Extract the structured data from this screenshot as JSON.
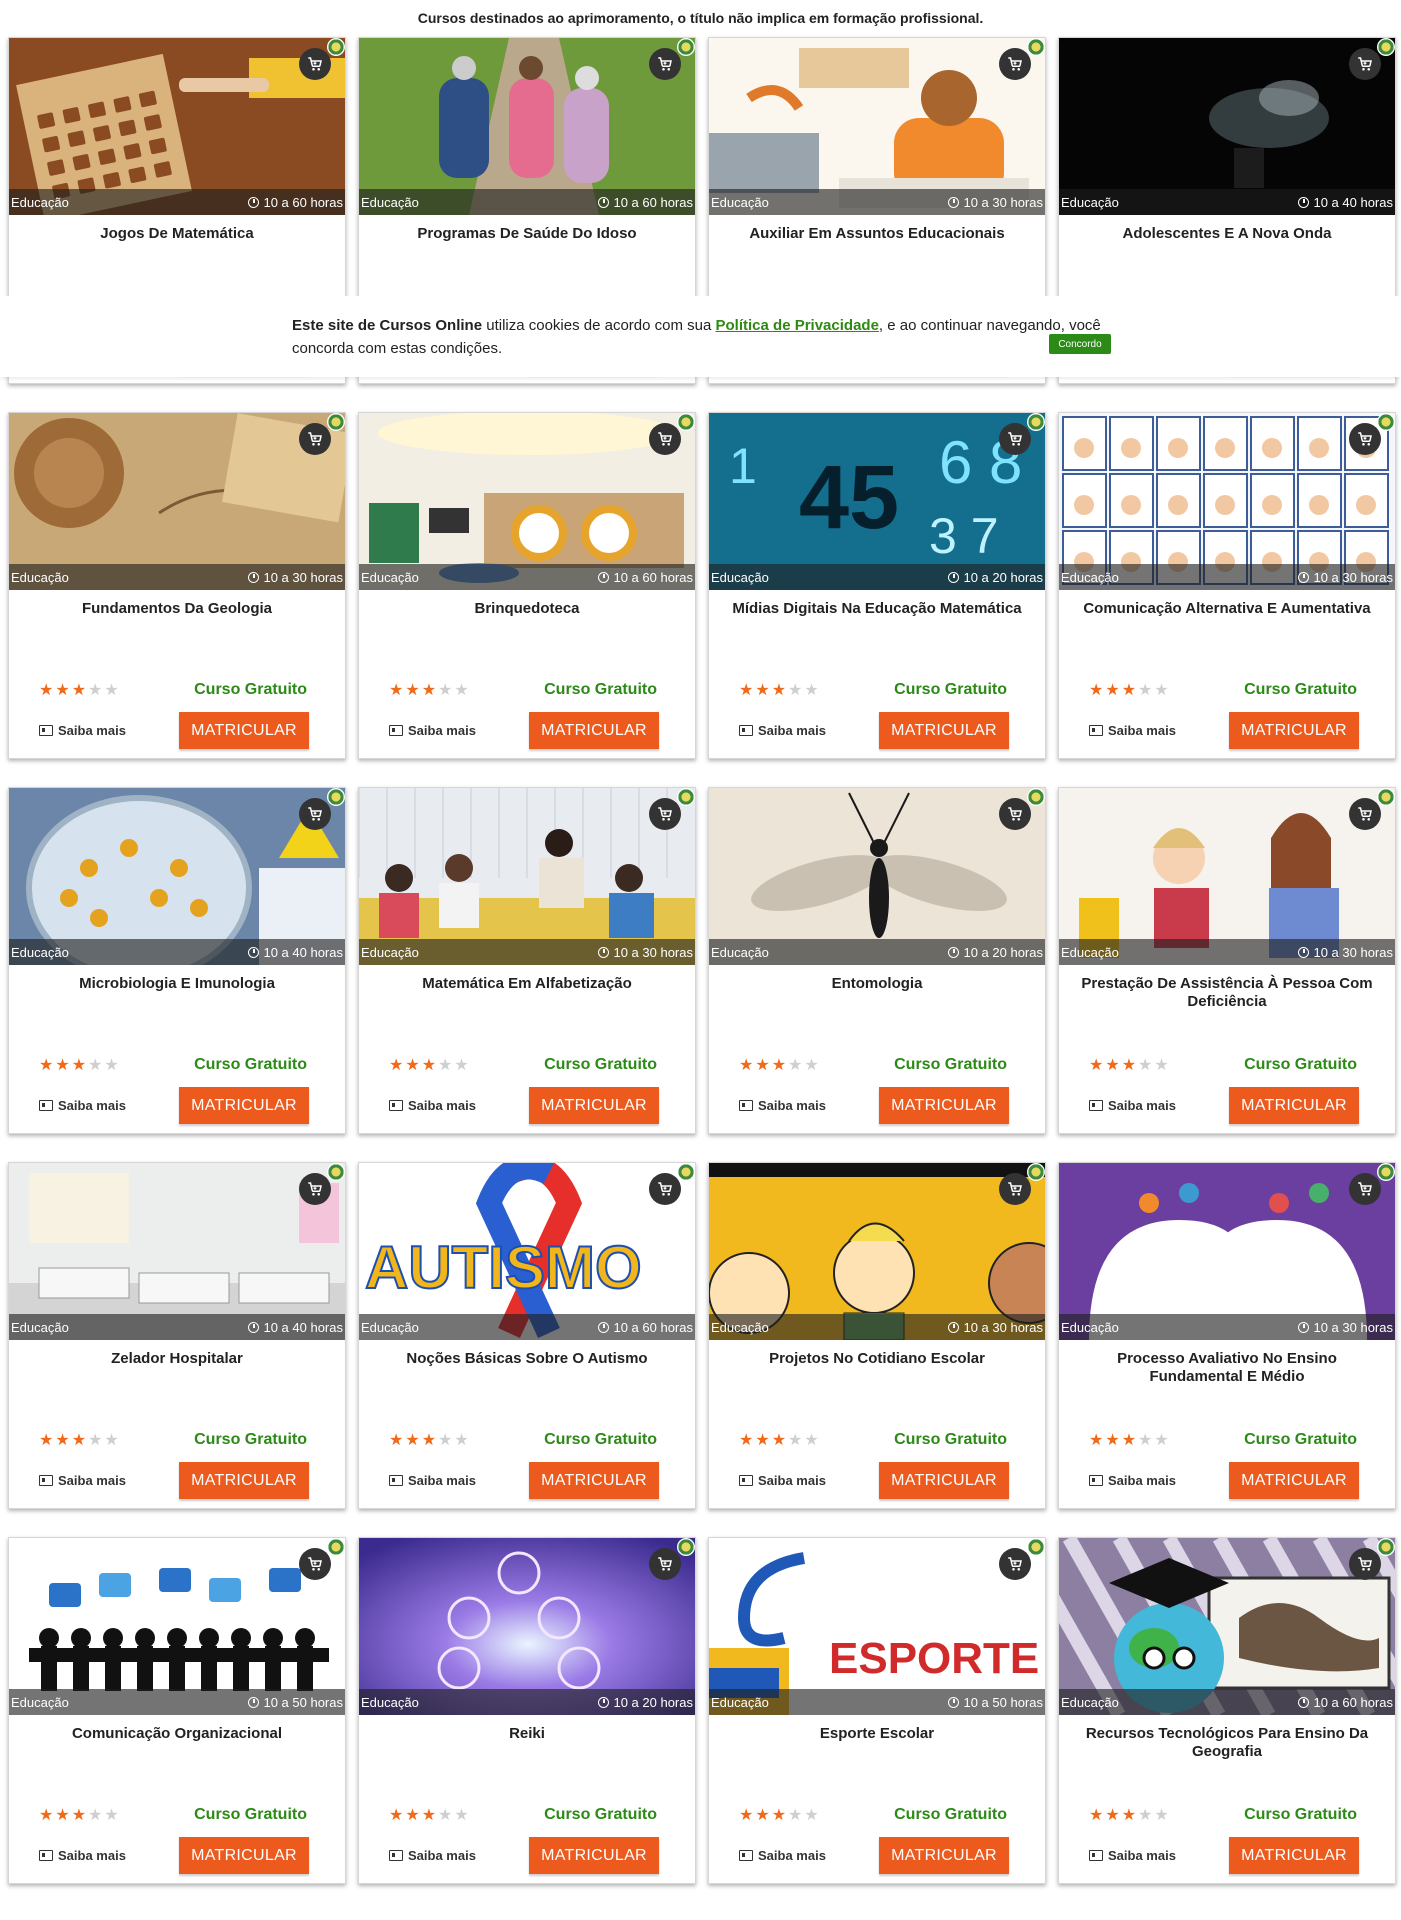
{
  "disclaimer": "Cursos destinados ao aprimoramento, o título não implica em formação profissional.",
  "labels": {
    "free": "Curso Gratuito",
    "more": "Saiba mais",
    "enroll": "MATRICULAR"
  },
  "cookie": {
    "site_name": "Este site de Cursos Online",
    "text_before": " utiliza cookies de acordo com sua ",
    "link": "Política de Privacidade",
    "text_after": ", e ao continuar navegando, você concorda com estas condições.",
    "button": "Concordo"
  },
  "colors": {
    "accent_orange": "#ec5a1e",
    "free_green": "#2c8a17",
    "star_on": "#f06a1a",
    "star_off": "#cfcfcf"
  },
  "icons": [
    "cart-icon",
    "clock-icon",
    "id-card-icon",
    "star-icon"
  ],
  "courses": [
    {
      "category": "Educação",
      "hours": "10 a 60 horas",
      "title": "Jogos De Matemática",
      "rating": 3,
      "image": "math-board-game"
    },
    {
      "category": "Educação",
      "hours": "10 a 60 horas",
      "title": "Programas De Saúde Do Idoso",
      "rating": 3,
      "image": "elderly-walking"
    },
    {
      "category": "Educação",
      "hours": "10 a 30 horas",
      "title": "Auxiliar Em Assuntos Educacionais",
      "rating": 3,
      "image": "student-illustration"
    },
    {
      "category": "Educação",
      "hours": "10 a 40 horas",
      "title": "Adolescentes E A Nova Onda",
      "rating": 3,
      "image": "smoke-dark"
    },
    {
      "category": "Educação",
      "hours": "10 a 30 horas",
      "title": "Fundamentos Da Geologia",
      "rating": 3,
      "image": "rope-map"
    },
    {
      "category": "Educação",
      "hours": "10 a 60 horas",
      "title": "Brinquedoteca",
      "rating": 3,
      "image": "playroom"
    },
    {
      "category": "Educação",
      "hours": "10 a 20 horas",
      "title": "Mídias Digitais Na Educação Matemática",
      "rating": 3,
      "image": "digital-numbers"
    },
    {
      "category": "Educação",
      "hours": "10 a 30 horas",
      "title": "Comunicação Alternativa E Aumentativa",
      "rating": 3,
      "image": "body-parts-chart"
    },
    {
      "category": "Educação",
      "hours": "10 a 40 horas",
      "title": "Microbiologia E Imunologia",
      "rating": 3,
      "image": "petri-dish"
    },
    {
      "category": "Educação",
      "hours": "10 a 30 horas",
      "title": "Matemática Em Alfabetização",
      "rating": 3,
      "image": "classroom-group"
    },
    {
      "category": "Educação",
      "hours": "10 a 20 horas",
      "title": "Entomologia",
      "rating": 3,
      "image": "insect"
    },
    {
      "category": "Educação",
      "hours": "10 a 30 horas",
      "title": "Prestação De Assistência À Pessoa Com Deficiência",
      "rating": 3,
      "image": "mother-child"
    },
    {
      "category": "Educação",
      "hours": "10 a 40 horas",
      "title": "Zelador Hospitalar",
      "rating": 3,
      "image": "hospital-beds"
    },
    {
      "category": "Educação",
      "hours": "10 a 60 horas",
      "title": "Noções Básicas Sobre O Autismo",
      "rating": 3,
      "image": "autism-ribbon",
      "image_text": "AUTISMO"
    },
    {
      "category": "Educação",
      "hours": "10 a 30 horas",
      "title": "Projetos No Cotidiano Escolar",
      "rating": 3,
      "image": "cartoon-yellow"
    },
    {
      "category": "Educação",
      "hours": "10 a 30 horas",
      "title": "Processo Avaliativo No Ensino Fundamental E Médio",
      "rating": 3,
      "image": "heads-purple"
    },
    {
      "category": "Educação",
      "hours": "10 a 50 horas",
      "title": "Comunicação Organizacional",
      "rating": 3,
      "image": "meeting-silhouettes"
    },
    {
      "category": "Educação",
      "hours": "10 a 20 horas",
      "title": "Reiki",
      "rating": 3,
      "image": "reiki-galaxy"
    },
    {
      "category": "Educação",
      "hours": "10 a 50 horas",
      "title": "Esporte Escolar",
      "rating": 3,
      "image": "sport-logo",
      "image_text": "ESPORTE NA ESCOLA"
    },
    {
      "category": "Educação",
      "hours": "10 a 60 horas",
      "title": "Recursos Tecnológicos Para Ensino Da Geografia",
      "rating": 3,
      "image": "globe-graduation"
    }
  ]
}
